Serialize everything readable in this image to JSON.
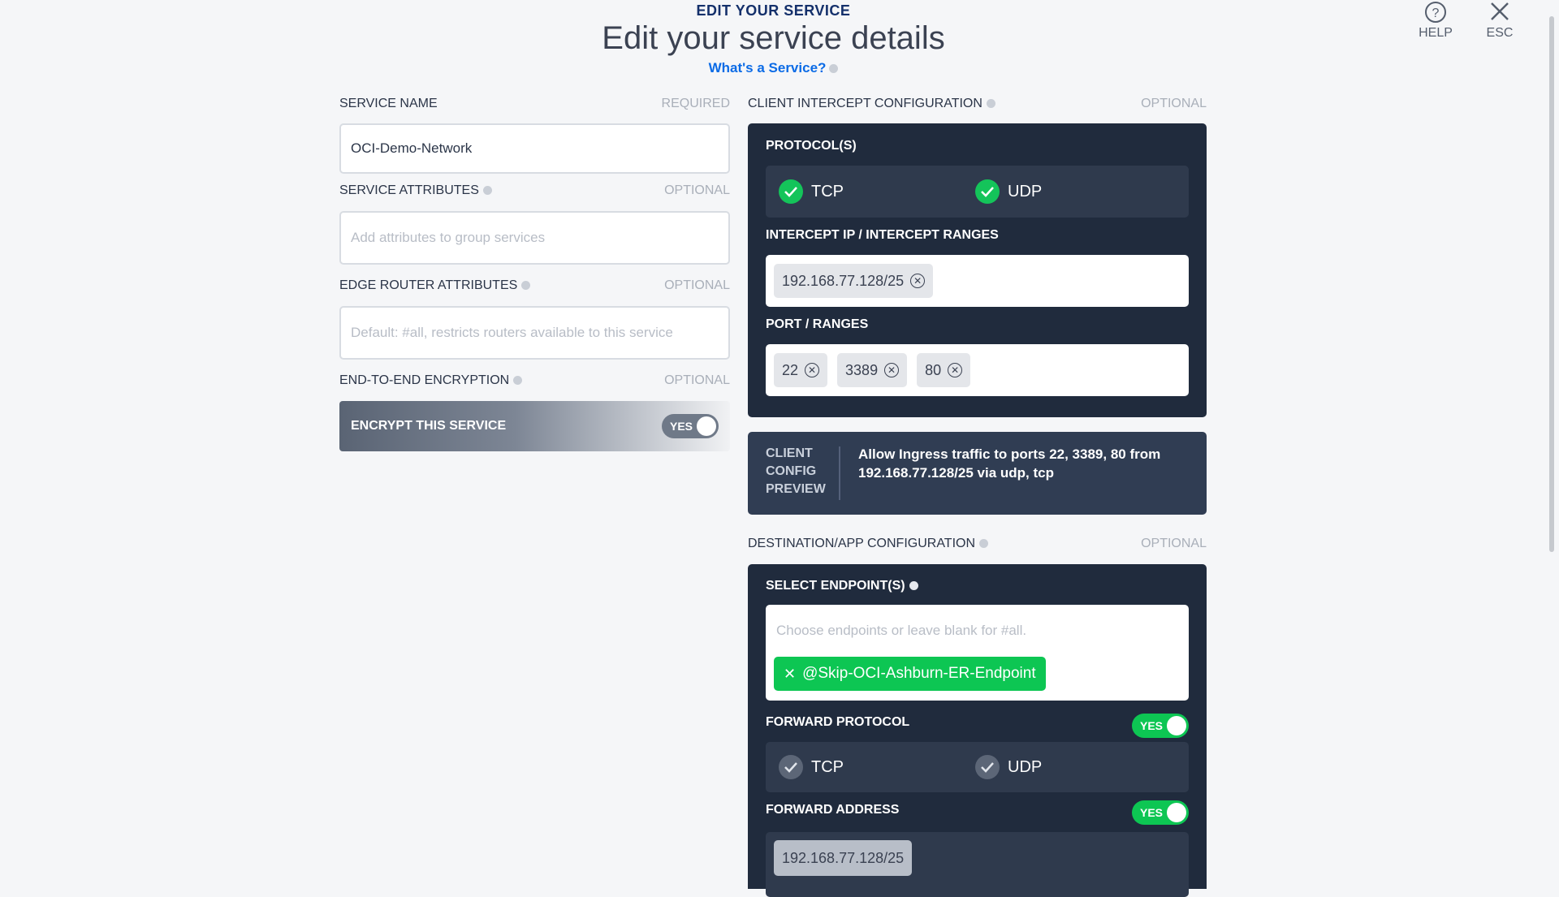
{
  "header": {
    "eyebrow": "EDIT YOUR SERVICE",
    "title": "Edit your service details",
    "link": "What's a Service?"
  },
  "actions": {
    "help": "HELP",
    "esc": "ESC"
  },
  "left": {
    "service_name": {
      "label": "SERVICE NAME",
      "note": "REQUIRED",
      "value": "OCI-Demo-Network"
    },
    "service_attributes": {
      "label": "SERVICE ATTRIBUTES",
      "note": "OPTIONAL",
      "placeholder": "Add attributes to group services"
    },
    "edge_router_attributes": {
      "label": "EDGE ROUTER ATTRIBUTES",
      "note": "OPTIONAL",
      "placeholder": "Default: #all, restricts routers available to this service"
    },
    "encryption": {
      "label": "END-TO-END ENCRYPTION",
      "note": "OPTIONAL",
      "bar_label": "ENCRYPT THIS SERVICE",
      "toggle": "YES"
    }
  },
  "client_intercept": {
    "label": "CLIENT INTERCEPT CONFIGURATION",
    "note": "OPTIONAL",
    "protocols_title": "PROTOCOL(S)",
    "protocols": [
      "TCP",
      "UDP"
    ],
    "intercept_title": "INTERCEPT IP / INTERCEPT RANGES",
    "intercept_values": [
      "192.168.77.128/25"
    ],
    "ports_title": "PORT / RANGES",
    "ports": [
      "22",
      "3389",
      "80"
    ]
  },
  "preview": {
    "label_lines": [
      "CLIENT",
      "CONFIG",
      "PREVIEW"
    ],
    "text": "Allow Ingress traffic to ports 22, 3389, 80 from 192.168.77.128/25 via udp, tcp"
  },
  "destination": {
    "label": "DESTINATION/APP CONFIGURATION",
    "note": "OPTIONAL",
    "endpoints_title": "SELECT ENDPOINT(S)",
    "endpoints_placeholder": "Choose endpoints or leave blank for #all.",
    "endpoint_tag": "@Skip-OCI-Ashburn-ER-Endpoint",
    "forward_protocol_title": "FORWARD PROTOCOL",
    "forward_protocol_toggle": "YES",
    "forward_protocols": [
      "TCP",
      "UDP"
    ],
    "forward_address_title": "FORWARD ADDRESS",
    "forward_address_toggle": "YES",
    "forward_address_value": "192.168.77.128/25"
  }
}
